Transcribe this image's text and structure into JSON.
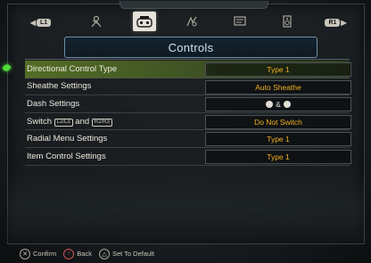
{
  "tabs": [
    {
      "name": "hunter",
      "icon": "hunter-icon"
    },
    {
      "name": "controls",
      "icon": "gamepad-icon",
      "active": true
    },
    {
      "name": "graphics",
      "icon": "graphics-icon"
    },
    {
      "name": "display",
      "icon": "display-icon"
    },
    {
      "name": "audio",
      "icon": "audio-icon"
    }
  ],
  "bumpers": {
    "left": "L1",
    "right": "R1"
  },
  "heading": "Controls",
  "rows": [
    {
      "label": "Directional Control Type",
      "value": "Type 1",
      "selected": true
    },
    {
      "label": "Sheathe Settings",
      "value": "Auto Sheathe"
    },
    {
      "label": "Dash Settings",
      "value": "&"
    },
    {
      "label_pre": "Switch",
      "label_mid": "and",
      "value": "Do Not Switch"
    },
    {
      "label": "Radial Menu Settings",
      "value": "Type 1"
    },
    {
      "label": "Item Control Settings",
      "value": "Type 1"
    }
  ],
  "footer": {
    "confirm": "Confirm",
    "back": "Back",
    "default": "Set To Default"
  },
  "colors": {
    "selected_row": "#82af28",
    "value_text": "#f0b020",
    "heading_border": "#6c8fa6",
    "cursor": "#4ddc3a"
  }
}
